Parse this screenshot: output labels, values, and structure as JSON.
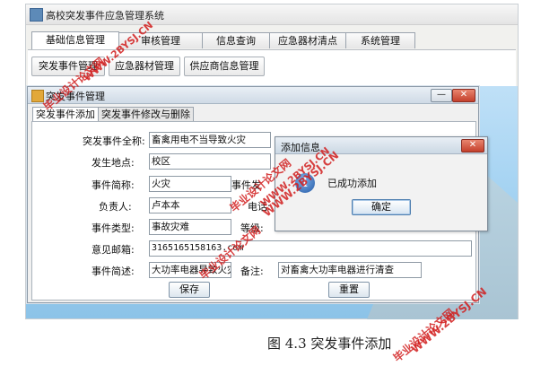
{
  "main_window": {
    "title": "高校突发事件应急管理系统",
    "tabs": [
      "基础信息管理",
      "审核管理",
      "信息查询",
      "应急器材清点",
      "系统管理"
    ],
    "sub_buttons": [
      "突发事件管理",
      "应急器材管理",
      "供应商信息管理"
    ]
  },
  "inner_frame": {
    "title": "突发事件管理",
    "minimize": "—",
    "close": "✕",
    "tabs": [
      "突发事件添加",
      "突发事件修改与删除"
    ]
  },
  "form": {
    "full_name_label": "突发事件全称:",
    "full_name_value": "畜禽用电不当导致火灾",
    "location_label": "发生地点:",
    "location_value": "校区",
    "short_name_label": "事件简称:",
    "short_name_value": "火灾",
    "event_date_label": "事件发",
    "leader_label": "负责人:",
    "leader_value": "卢本本",
    "phone_label": "电话:",
    "type_label": "事件类型:",
    "type_value": "事故灾难",
    "level_label": "等级:",
    "email_label": "意见邮箱:",
    "email_value": "3165165158163.com",
    "desc_label": "事件简述:",
    "desc_value": "大功率电器导致火灾",
    "note_label": "备注:",
    "note_value": "对畜禽大功率电器进行清查",
    "save_button": "保存",
    "reset_button": "重置"
  },
  "dialog": {
    "title": "添加信息",
    "close": "✕",
    "icon_glyph": "i",
    "message": "已成功添加",
    "ok_button": "确定"
  },
  "watermark": {
    "text_cn": "毕业设计论文网",
    "text_url": "WWW.2BYSJ.CN"
  },
  "caption": "图 4.3  突发事件添加"
}
